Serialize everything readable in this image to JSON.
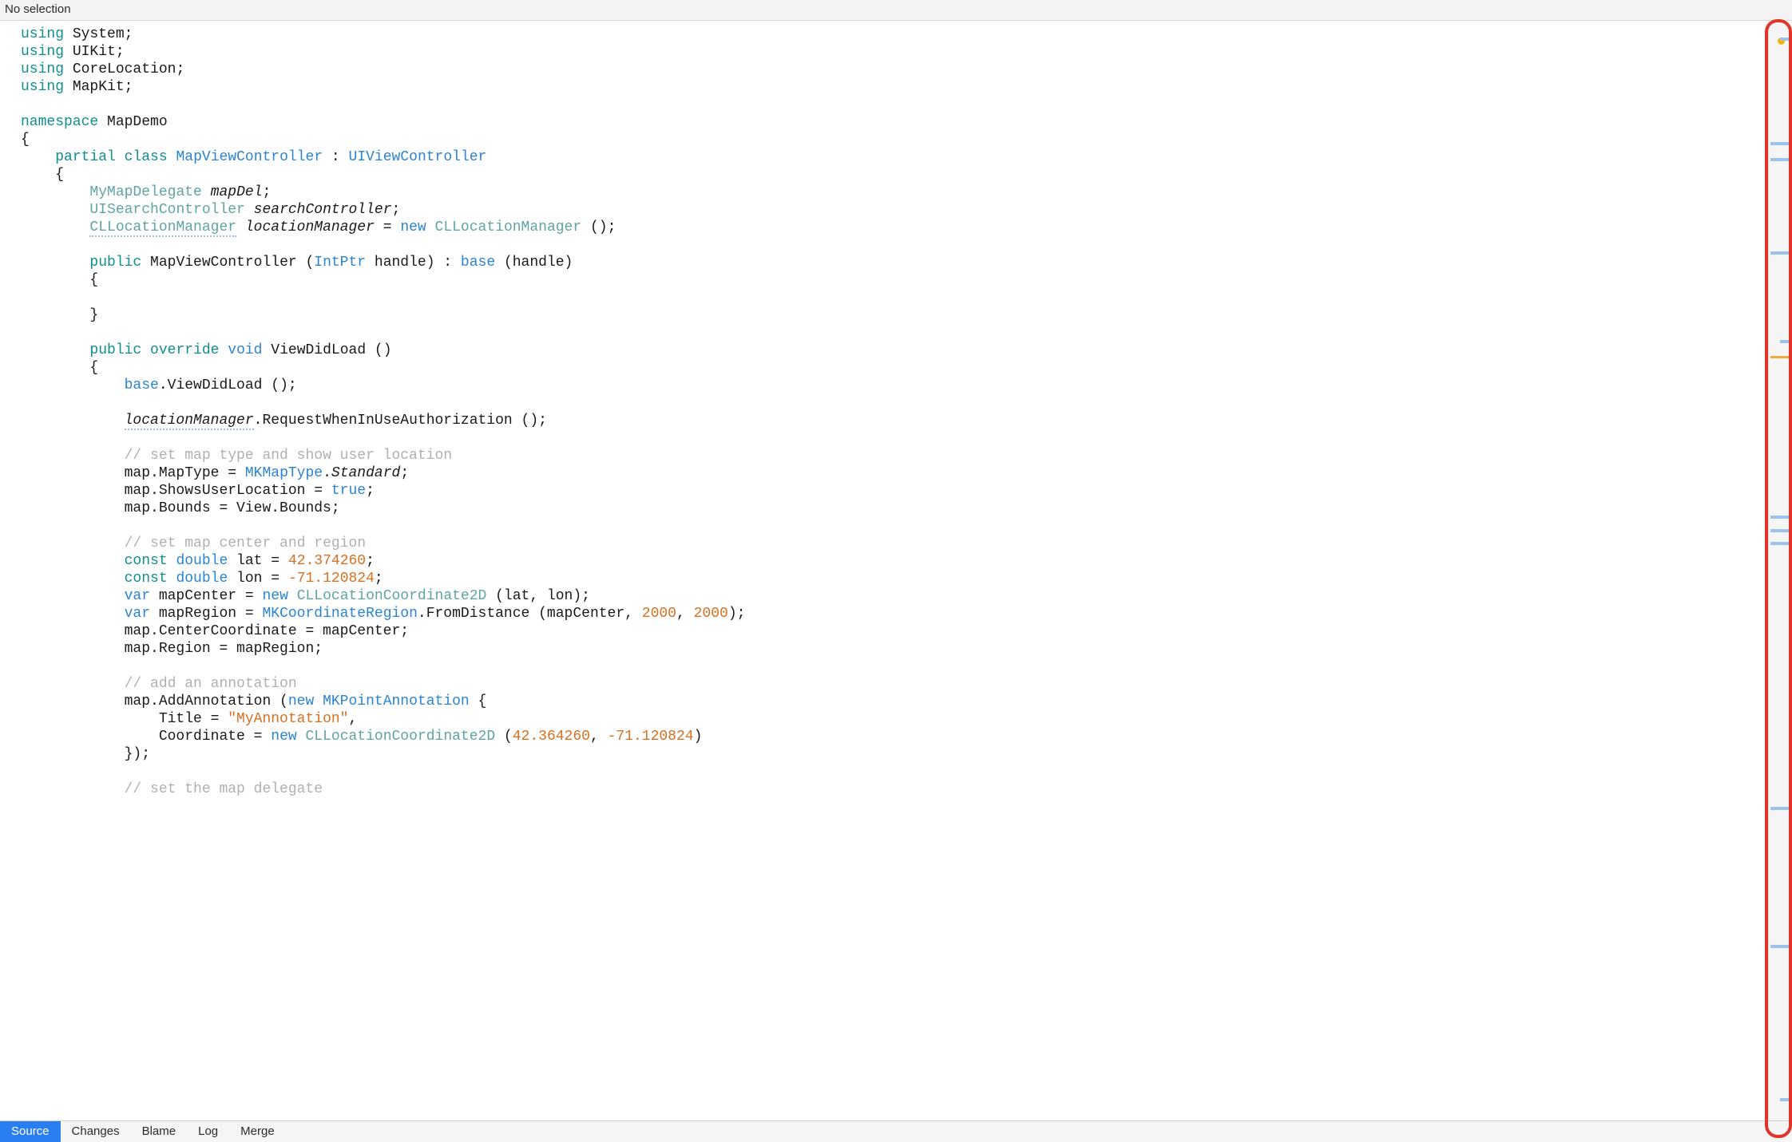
{
  "topbar": {
    "title": "No selection"
  },
  "colors": {
    "accent": "#297ef2",
    "callout": "#e1352a",
    "keyword_teal": "#0f8f8f",
    "keyword_blue": "#2a84d6",
    "comment": "#b0b0b0",
    "literal": "#d96f1f"
  },
  "bottom_tabs": {
    "items": [
      {
        "label": "Source",
        "active": true
      },
      {
        "label": "Changes",
        "active": false
      },
      {
        "label": "Blame",
        "active": false
      },
      {
        "label": "Log",
        "active": false
      },
      {
        "label": "Merge",
        "active": false
      }
    ]
  },
  "code": {
    "usings": [
      "System",
      "UIKit",
      "CoreLocation",
      "MapKit"
    ],
    "namespace": "MapDemo",
    "class_decl": {
      "modifiers": "partial class",
      "name": "MapViewController",
      "base": "UIViewController"
    },
    "fields": [
      {
        "type": "MyMapDelegate",
        "name": "mapDel"
      },
      {
        "type": "UISearchController",
        "name": "searchController"
      },
      {
        "type": "CLLocationManager",
        "name": "locationManager",
        "init": "new CLLocationManager ()"
      }
    ],
    "ctor": {
      "signature": "public MapViewController (IntPtr handle) : base (handle)"
    },
    "method": {
      "signature": "public override void ViewDidLoad ()",
      "body_lines": [
        "base.ViewDidLoad ();",
        "",
        "locationManager.RequestWhenInUseAuthorization ();",
        "",
        "// set map type and show user location",
        "map.MapType = MKMapType.Standard;",
        "map.ShowsUserLocation = true;",
        "map.Bounds = View.Bounds;",
        "",
        "// set map center and region",
        "const double lat = 42.374260;",
        "const double lon = -71.120824;",
        "var mapCenter = new CLLocationCoordinate2D (lat, lon);",
        "var mapRegion = MKCoordinateRegion.FromDistance (mapCenter, 2000, 2000);",
        "map.CenterCoordinate = mapCenter;",
        "map.Region = mapRegion;",
        "",
        "// add an annotation",
        "map.AddAnnotation (new MKPointAnnotation {",
        "    Title = \"MyAnnotation\",",
        "    Coordinate = new CLLocationCoordinate2D (42.364260, -71.120824)",
        "});",
        "",
        "// set the map delegate"
      ]
    }
  },
  "minimap": {
    "warning_dot_top_pct": 1.5,
    "marks": [
      {
        "kind": "blue",
        "top_pct": 1.5,
        "half": true
      },
      {
        "kind": "blue",
        "top_pct": 11
      },
      {
        "kind": "blue",
        "top_pct": 12.5
      },
      {
        "kind": "blue",
        "top_pct": 21
      },
      {
        "kind": "blue",
        "top_pct": 29,
        "half": true
      },
      {
        "kind": "orange",
        "top_pct": 30.5
      },
      {
        "kind": "blue",
        "top_pct": 45
      },
      {
        "kind": "blue",
        "top_pct": 46.2
      },
      {
        "kind": "blue",
        "top_pct": 47.4
      },
      {
        "kind": "blue",
        "top_pct": 71.5
      },
      {
        "kind": "blue",
        "top_pct": 84
      },
      {
        "kind": "blue",
        "top_pct": 98,
        "half": true
      }
    ]
  }
}
